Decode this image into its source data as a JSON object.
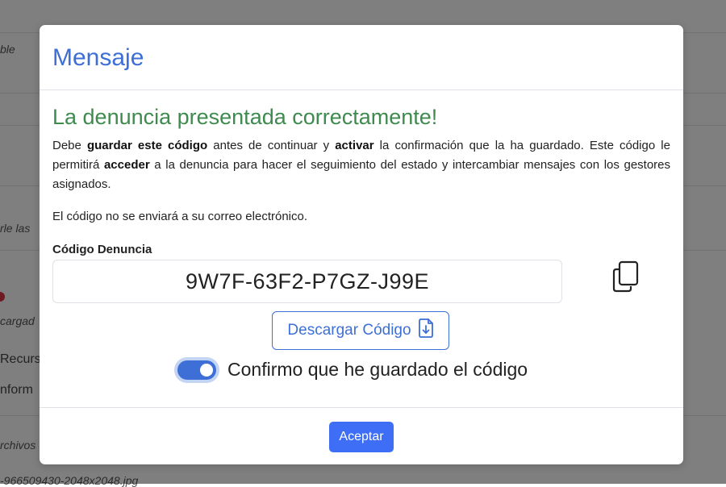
{
  "background": {
    "fragments": [
      "ble",
      "rle las",
      "cargad",
      "Recurs",
      "nform",
      "rchivos",
      "-966509430-2048x2048.jpg"
    ]
  },
  "modal": {
    "title": "Mensaje",
    "success_title": "La denuncia presentada correctamente!",
    "paragraph": {
      "t1": "Debe ",
      "b1": "guardar este código",
      "t2": " antes de continuar y ",
      "b2": "activar",
      "t3": " la confirmación que la ha guardado. Este código le permitirá ",
      "b3": "acceder",
      "t4": " a la denuncia para hacer el seguimiento del estado y intercambiar mensajes con los gestores asignados."
    },
    "email_notice": "El código no se enviará a su correo electrónico.",
    "code_label": "Código Denuncia",
    "code_value": "9W7F-63F2-P7GZ-J99E",
    "download_label": "Descargar Código",
    "confirm_label": "Confirmo que he guardado el código",
    "confirm_checked": true,
    "accept_label": "Aceptar"
  },
  "colors": {
    "primary": "#3d6fd6",
    "success": "#3f8a4e",
    "accept_button": "#3d6ef5"
  },
  "icons": {
    "copy": "copy-icon",
    "download": "file-download-icon"
  }
}
